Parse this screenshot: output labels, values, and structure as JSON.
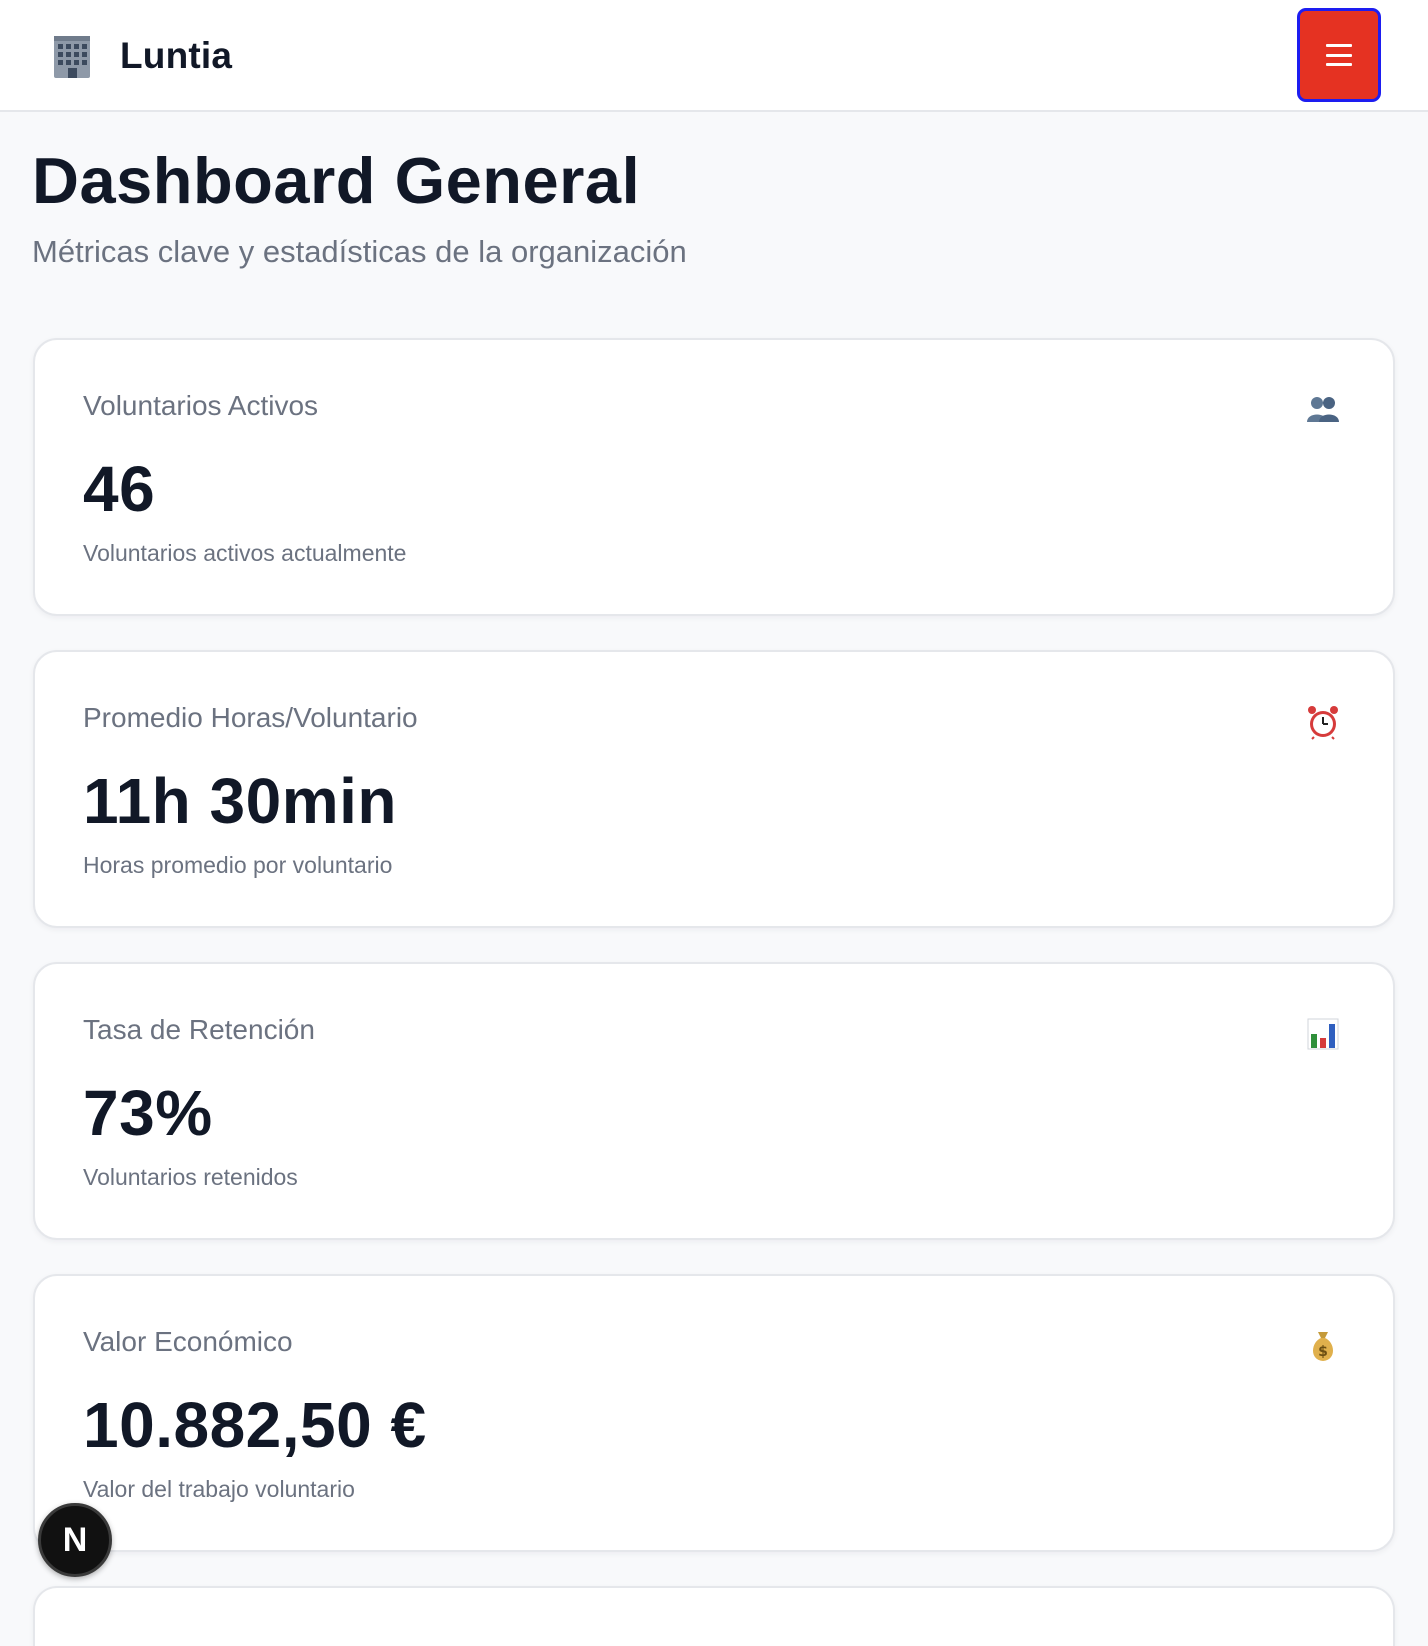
{
  "header": {
    "brand_icon": "office-building-icon",
    "brand_name": "Luntia",
    "menu_icon": "hamburger-menu-icon",
    "menu_button_color": "#e53222",
    "menu_button_border": "#1d1df0"
  },
  "page": {
    "title": "Dashboard General",
    "subtitle": "Métricas clave y estadísticas de la organización"
  },
  "cards": [
    {
      "label": "Voluntarios Activos",
      "value": "46",
      "description": "Voluntarios activos actualmente",
      "icon": "people-icon"
    },
    {
      "label": "Promedio Horas/Voluntario",
      "value": "11h 30min",
      "description": "Horas promedio por voluntario",
      "icon": "alarm-clock-icon"
    },
    {
      "label": "Tasa de Retención",
      "value": "73%",
      "description": "Voluntarios retenidos",
      "icon": "bar-chart-icon"
    },
    {
      "label": "Valor Económico",
      "value": "10.882,50 €",
      "description": "Valor del trabajo voluntario",
      "icon": "money-bag-icon"
    }
  ],
  "dev_badge": {
    "icon": "nextjs-logo-icon",
    "letter": "N"
  }
}
